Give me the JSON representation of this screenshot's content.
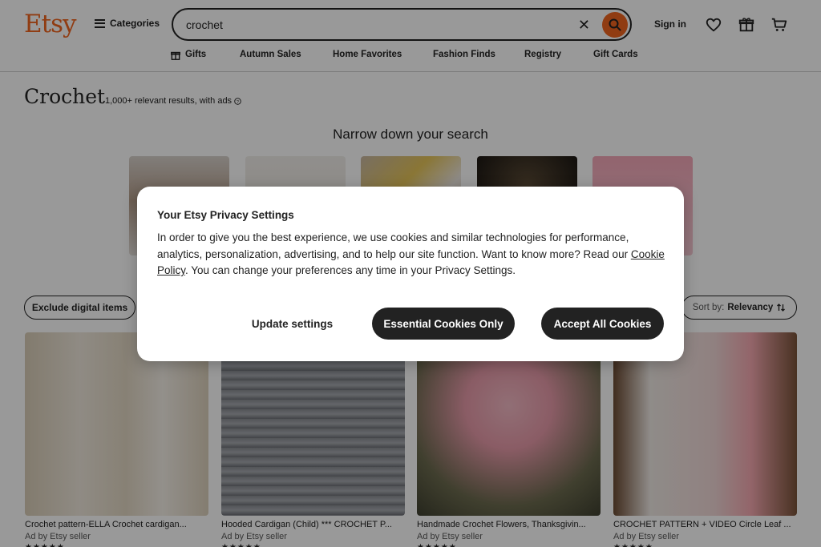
{
  "header": {
    "logo": "Etsy",
    "categories_label": "Categories",
    "search_value": "crochet",
    "signin_label": "Sign in"
  },
  "subnav": {
    "items": [
      "Gifts",
      "Autumn Sales",
      "Home Favorites",
      "Fashion Finds",
      "Registry",
      "Gift Cards"
    ]
  },
  "page": {
    "title": "Crochet",
    "results_text": "1,000+ relevant results, with ads",
    "narrow_heading": "Narrow down your search"
  },
  "filters": {
    "exclude_label": "Exclude digital items",
    "sort_prefix": "Sort by:",
    "sort_value": "Relevancy"
  },
  "listings": [
    {
      "title": "Crochet pattern-ELLA Crochet cardigan...",
      "ad": "Ad by Etsy seller"
    },
    {
      "title": "Hooded Cardigan (Child) *** CROCHET P...",
      "ad": "Ad by Etsy seller"
    },
    {
      "title": "Handmade Crochet Flowers, Thanksgivin...",
      "ad": "Ad by Etsy seller"
    },
    {
      "title": "CROCHET PATTERN + VIDEO Circle Leaf ...",
      "ad": "Ad by Etsy seller"
    }
  ],
  "modal": {
    "title": "Your Etsy Privacy Settings",
    "body_before": "In order to give you the best experience, we use cookies and similar technologies for performance, analytics, personalization, advertising, and to help our site function. Want to know more? Read our ",
    "link": "Cookie Policy",
    "body_after": ". You can change your preferences any time in your Privacy Settings.",
    "update_label": "Update settings",
    "essential_label": "Essential Cookies Only",
    "accept_label": "Accept All Cookies"
  },
  "colors": {
    "brand": "#F1641E",
    "button_dark": "#222222"
  },
  "icons": [
    "hamburger-icon",
    "close-icon",
    "search-icon",
    "heart-icon",
    "gift-icon",
    "cart-icon",
    "info-icon",
    "sort-icon"
  ]
}
